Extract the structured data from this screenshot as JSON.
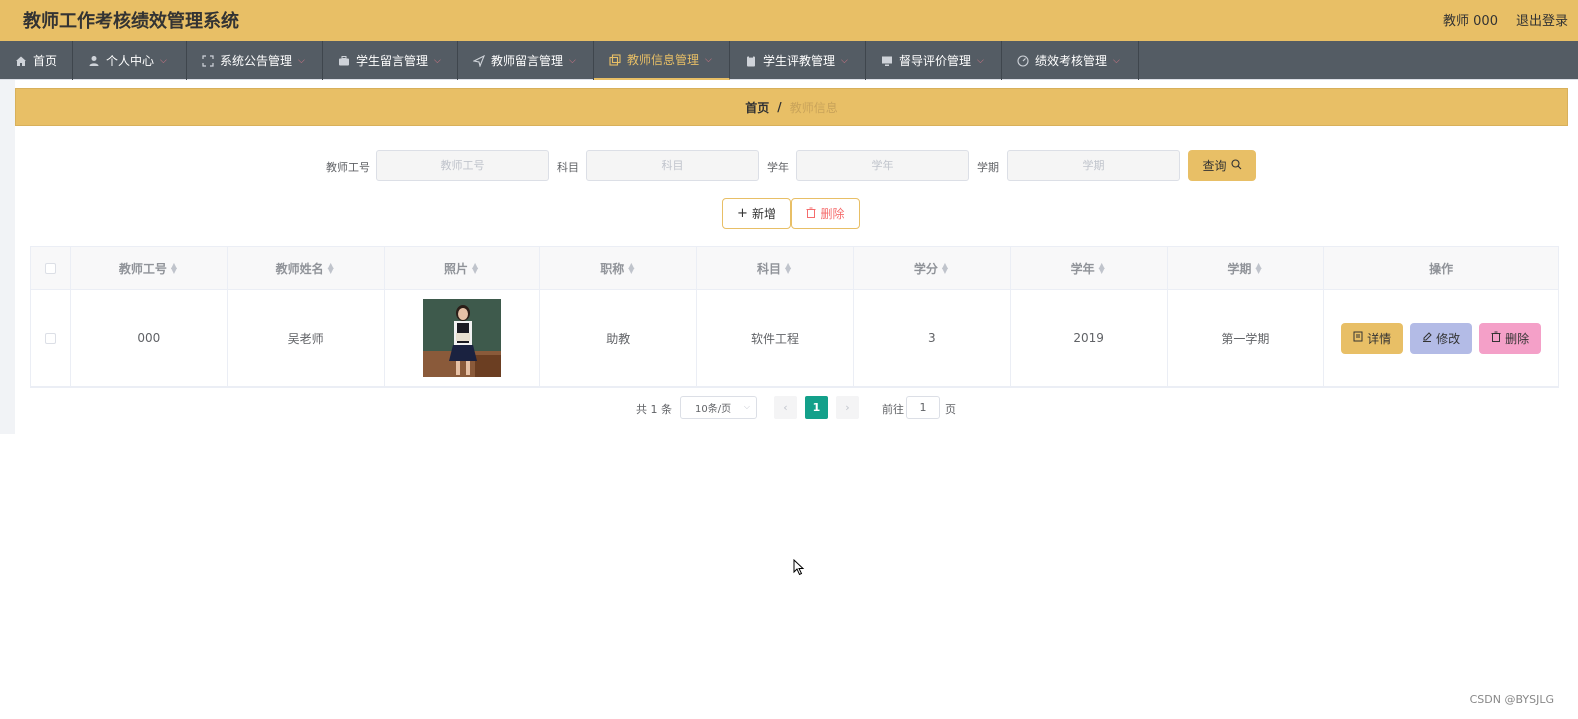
{
  "header": {
    "title": "教师工作考核绩效管理系统",
    "user": "教师 000",
    "logout": "退出登录"
  },
  "nav": {
    "items": [
      {
        "label": "首页",
        "icon": "home-icon"
      },
      {
        "label": "个人中心",
        "icon": "user-icon"
      },
      {
        "label": "系统公告管理",
        "icon": "fullscreen-icon"
      },
      {
        "label": "学生留言管理",
        "icon": "briefcase-icon"
      },
      {
        "label": "教师留言管理",
        "icon": "send-icon"
      },
      {
        "label": "教师信息管理",
        "icon": "copy-icon"
      },
      {
        "label": "学生评教管理",
        "icon": "clipboard-icon"
      },
      {
        "label": "督导评价管理",
        "icon": "monitor-icon"
      },
      {
        "label": "绩效考核管理",
        "icon": "dashboard-icon"
      }
    ]
  },
  "breadcrumb": {
    "home": "首页",
    "separator": "/",
    "current": "教师信息"
  },
  "search": {
    "teacher_id_label": "教师工号",
    "teacher_id_placeholder": "教师工号",
    "subject_label": "科目",
    "subject_placeholder": "科目",
    "year_label": "学年",
    "year_placeholder": "学年",
    "term_label": "学期",
    "term_placeholder": "学期",
    "query_button": "查询"
  },
  "actions": {
    "add": "新增",
    "delete": "删除"
  },
  "table": {
    "headers": [
      "教师工号",
      "教师姓名",
      "照片",
      "职称",
      "科目",
      "学分",
      "学年",
      "学期",
      "操作"
    ],
    "rows": [
      {
        "teacher_id": "000",
        "name": "吴老师",
        "title": "助教",
        "subject": "软件工程",
        "credit": "3",
        "year": "2019",
        "term": "第一学期",
        "detail": "详情",
        "edit": "修改",
        "delete": "删除"
      }
    ]
  },
  "pagination": {
    "total": "共 1 条",
    "page_size": "10条/页",
    "current_page": "1",
    "goto": "前往",
    "goto_value": "1",
    "page_suffix": "页"
  },
  "footer": {
    "watermark": "CSDN @BYSJLG"
  },
  "colors": {
    "accent": "#e8bf66",
    "nav_bg": "#545c64",
    "pager_active": "#13a08a",
    "edit_btn": "#b3bbe6",
    "delete_btn": "#f4a0c8"
  }
}
